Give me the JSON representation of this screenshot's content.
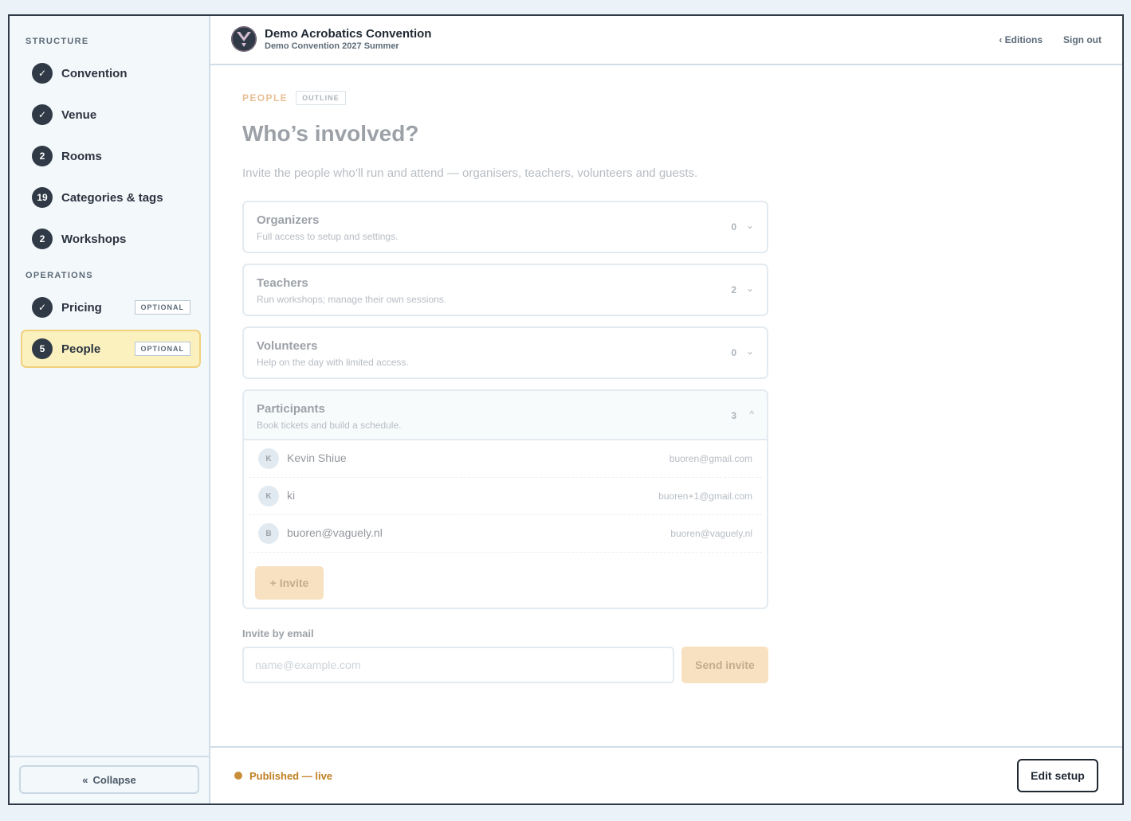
{
  "sidebar": {
    "structure_title": "STRUCTURE",
    "operations_title": "OPERATIONS",
    "structure_items": [
      {
        "label": "Convention",
        "badge": "✓"
      },
      {
        "label": "Venue",
        "badge": "✓"
      },
      {
        "label": "Rooms",
        "badge": "2"
      },
      {
        "label": "Categories & tags",
        "badge": "19"
      },
      {
        "label": "Workshops",
        "badge": "2"
      }
    ],
    "operations_items": [
      {
        "label": "Pricing",
        "badge": "✓",
        "tag": "OPTIONAL"
      },
      {
        "label": "People",
        "badge": "5",
        "tag": "OPTIONAL",
        "active": true
      }
    ],
    "collapse_icon": "«",
    "collapse_label": "Collapse"
  },
  "header": {
    "title": "Demo Acrobatics Convention",
    "subtitle": "Demo Convention 2027 Summer",
    "editions_link": "‹ Editions",
    "signout_link": "Sign out"
  },
  "main": {
    "eyebrow": "PEOPLE",
    "eyebrow_tag": "OUTLINE",
    "title": "Who’s involved?",
    "description": "Invite the people who’ll run and attend — organisers, teachers, volunteers and guests.",
    "roles": [
      {
        "name": "Organizers",
        "desc": "Full access to setup and settings.",
        "count": "0",
        "chevron": "⌄"
      },
      {
        "name": "Teachers",
        "desc": "Run workshops; manage their own sessions.",
        "count": "2",
        "chevron": "⌄"
      },
      {
        "name": "Volunteers",
        "desc": "Help on the day with limited access.",
        "count": "0",
        "chevron": "⌄"
      },
      {
        "name": "Participants",
        "desc": "Book tickets and build a schedule.",
        "count": "3",
        "chevron": "^"
      }
    ],
    "participants": [
      {
        "initial": "K",
        "name": "Kevin Shiue",
        "email": "buoren@gmail.com"
      },
      {
        "initial": "K",
        "name": "ki",
        "email": "buoren+1@gmail.com"
      },
      {
        "initial": "B",
        "name": "buoren@vaguely.nl",
        "email": "buoren@vaguely.nl"
      }
    ],
    "invite_button": "+ Invite",
    "email_label": "Invite by email",
    "email_placeholder": "name@example.com",
    "email_value": "",
    "send_button": "Send invite"
  },
  "footer": {
    "status": "Published — live",
    "edit_button": "Edit setup"
  },
  "colors": {
    "accent": "#f2c584",
    "active_bg": "#fbf1bf",
    "active_border": "#f1d07e",
    "status": "#c07f22",
    "dark": "#2f3a46"
  }
}
